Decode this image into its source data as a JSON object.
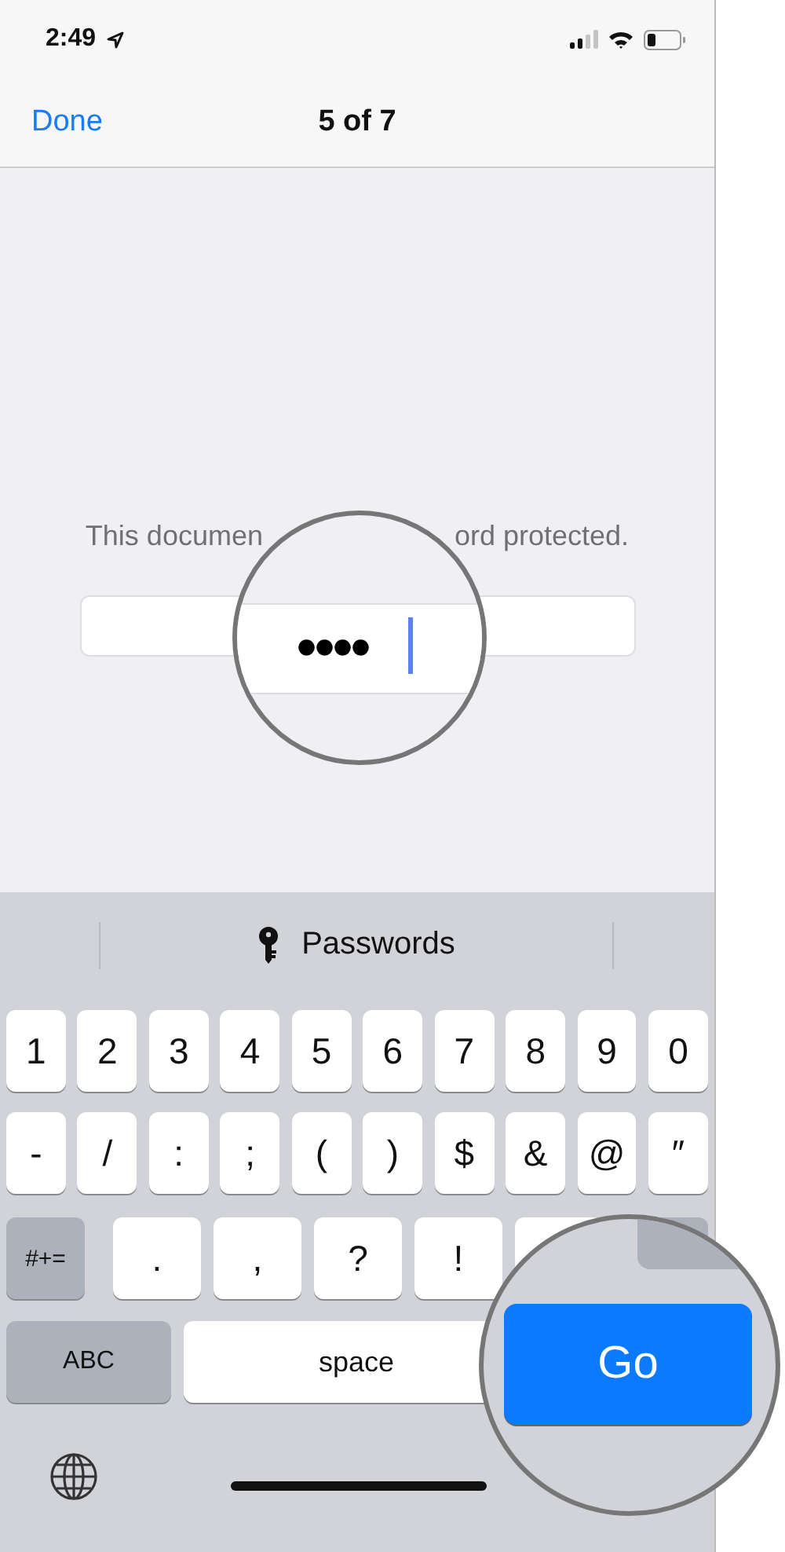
{
  "status_bar": {
    "time": "2:49"
  },
  "nav": {
    "done": "Done",
    "title": "5 of 7"
  },
  "prompt": {
    "left": "This documen",
    "right": "ord protected."
  },
  "password_magnifier": {
    "value": "●●●●"
  },
  "keyboard": {
    "suggestion": "Passwords",
    "number_row": [
      {
        "label": "1",
        "kind": "char"
      },
      {
        "label": "2",
        "kind": "char"
      },
      {
        "label": "3",
        "kind": "char"
      },
      {
        "label": "4",
        "kind": "char"
      },
      {
        "label": "5",
        "kind": "char"
      },
      {
        "label": "6",
        "kind": "char"
      },
      {
        "label": "7",
        "kind": "char"
      },
      {
        "label": "8",
        "kind": "char"
      },
      {
        "label": "9",
        "kind": "char"
      },
      {
        "label": "0",
        "kind": "char"
      }
    ],
    "symbol_row": [
      {
        "label": "-",
        "kind": "char"
      },
      {
        "label": "/",
        "kind": "char"
      },
      {
        "label": ":",
        "kind": "char"
      },
      {
        "label": ";",
        "kind": "char"
      },
      {
        "label": "(",
        "kind": "char"
      },
      {
        "label": ")",
        "kind": "char"
      },
      {
        "label": "$",
        "kind": "char"
      },
      {
        "label": "&",
        "kind": "char"
      },
      {
        "label": "@",
        "kind": "char"
      },
      {
        "label": "″",
        "kind": "char"
      }
    ],
    "punctuation_row": [
      {
        "label": "#+=",
        "kind": "mod"
      },
      {
        "label": ".",
        "kind": "char"
      },
      {
        "label": ",",
        "kind": "char"
      },
      {
        "label": "?",
        "kind": "char"
      },
      {
        "label": "!",
        "kind": "char"
      },
      {
        "kind": "char"
      },
      {
        "kind": "mod"
      }
    ],
    "bottom_row": [
      {
        "label": "ABC",
        "kind": "mod"
      },
      {
        "label": "space",
        "kind": "space"
      }
    ],
    "magnified_key": {
      "label": "Go"
    }
  }
}
